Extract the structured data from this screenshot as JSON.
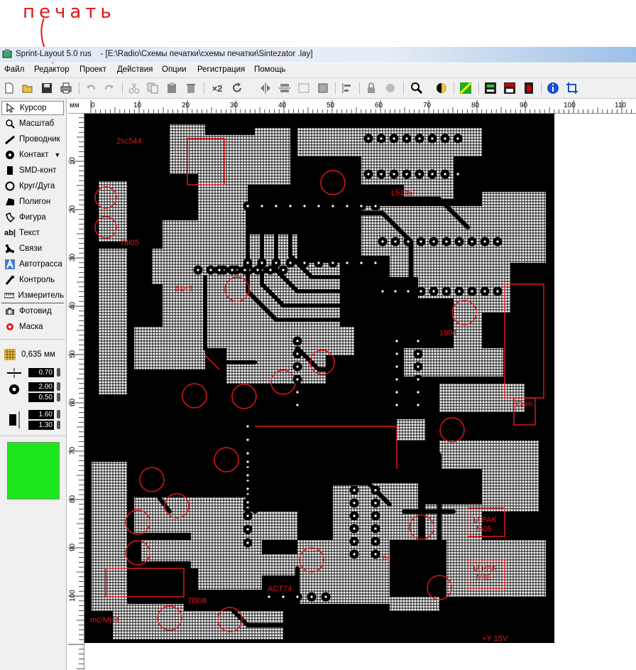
{
  "annotation": {
    "text": "печать"
  },
  "window": {
    "title": "Sprint-Layout 5.0 rus    - [E:\\Radio\\Схемы печатки\\схемы печатки\\Sintezator .lay]"
  },
  "menu": [
    "Файл",
    "Редактор",
    "Проект",
    "Действия",
    "Опции",
    "Регистрация",
    "Помощь"
  ],
  "toolbar": {
    "icons": [
      "new-file-icon",
      "open-folder-icon",
      "save-icon",
      "print-icon",
      "undo-icon",
      "redo-icon",
      "cut-icon",
      "copy-icon",
      "paste-icon",
      "delete-icon",
      "x2-icon",
      "rotate-icon",
      "mirror-h-icon",
      "mirror-v-icon",
      "group-icon",
      "ungroup-icon",
      "align-icon",
      "lock-icon",
      "unlock-icon",
      "zoom-icon",
      "layers-icon",
      "photo-icon",
      "test-icon",
      "drc-icon",
      "macro-icon",
      "info-icon",
      "crop-icon"
    ],
    "x2_label": "×2"
  },
  "tools": [
    {
      "label": "Курсор",
      "icon": "cursor-icon"
    },
    {
      "label": "Масштаб",
      "icon": "zoom-icon"
    },
    {
      "label": "Проводник",
      "icon": "track-icon"
    },
    {
      "label": "Контакт",
      "icon": "pad-icon"
    },
    {
      "label": "SMD-конт",
      "icon": "smd-pad-icon"
    },
    {
      "label": "Круг/Дуга",
      "icon": "circle-arc-icon"
    },
    {
      "label": "Полигон",
      "icon": "polygon-icon"
    },
    {
      "label": "Фигура",
      "icon": "figure-icon"
    },
    {
      "label": "Текст",
      "icon": "text-icon"
    },
    {
      "label": "Связи",
      "icon": "connections-icon"
    },
    {
      "label": "Автотрасса",
      "icon": "autoroute-icon"
    },
    {
      "label": "Контроль",
      "icon": "test-icon"
    },
    {
      "label": "Измеритель",
      "icon": "ruler-icon"
    },
    {
      "label": "Фотовид",
      "icon": "camera-icon"
    },
    {
      "label": "Маска",
      "icon": "mask-icon"
    }
  ],
  "grid": {
    "value": "0,635 мм"
  },
  "params": {
    "track_width": "0.70",
    "pad_outer": "2.00",
    "pad_inner": "0.50",
    "smd_w": "1.60",
    "smd_h": "1.30"
  },
  "ruler": {
    "unit": "мм",
    "h_labels": [
      "0",
      "10",
      "20",
      "30",
      "40",
      "50",
      "60",
      "70",
      "80",
      "90",
      "100",
      "110"
    ],
    "v_labels": [
      "10",
      "20",
      "30",
      "40",
      "50",
      "60",
      "70",
      "80",
      "90",
      "100"
    ]
  },
  "board_labels": [
    "2sc544",
    "L5145",
    "78l05",
    "5145",
    "74",
    "A",
    "L4",
    "ACT74",
    "78l08",
    "Com",
    "D-PAK M05",
    "D-PAK M09",
    "1904",
    "1904",
    "mc/MH4",
    "+Y 15V"
  ],
  "colors": {
    "accent_red": "#e0161b",
    "layer_color": "#1ce81c"
  }
}
